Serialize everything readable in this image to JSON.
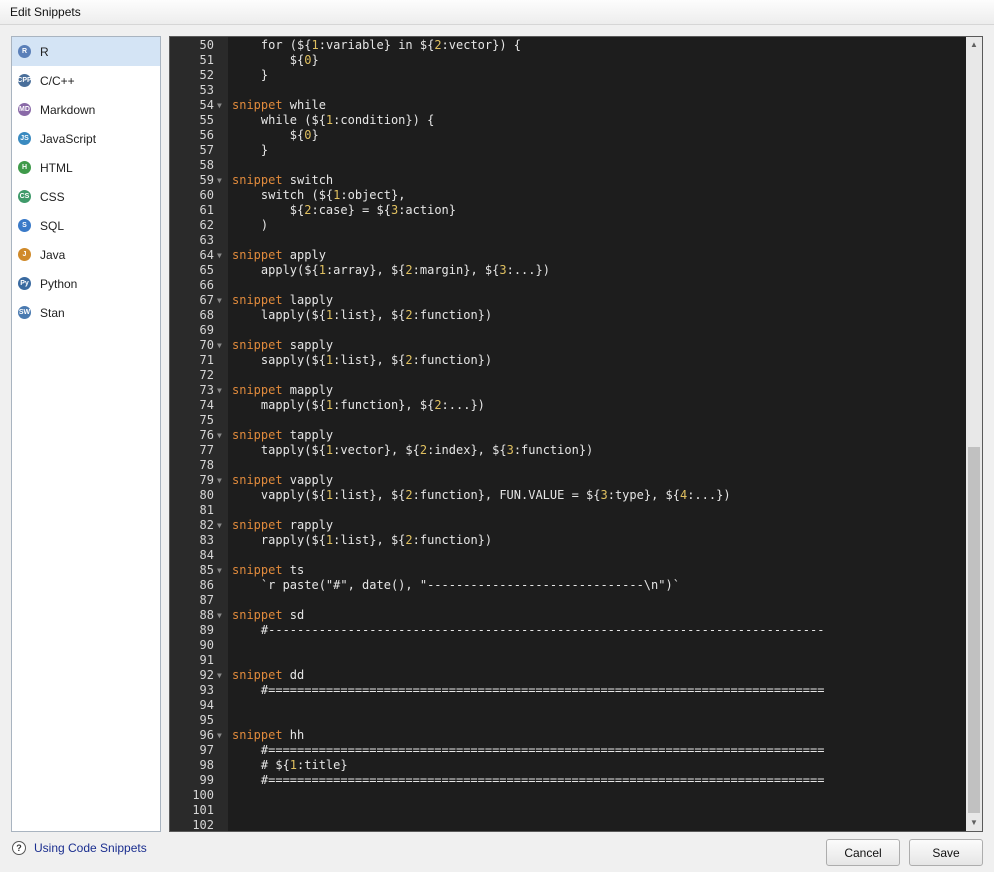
{
  "window": {
    "title": "Edit Snippets"
  },
  "languages": [
    {
      "label": "R",
      "icon": "r-icon",
      "color": "#5a7fb8",
      "glyph": "R",
      "selected": true
    },
    {
      "label": "C/C++",
      "icon": "cpp-icon",
      "color": "#4a6f9a",
      "glyph": "CPP",
      "selected": false
    },
    {
      "label": "Markdown",
      "icon": "markdown-icon",
      "color": "#8a6aa8",
      "glyph": "MD",
      "selected": false
    },
    {
      "label": "JavaScript",
      "icon": "javascript-icon",
      "color": "#3a8ac0",
      "glyph": "JS",
      "selected": false
    },
    {
      "label": "HTML",
      "icon": "html-icon",
      "color": "#3f9a4a",
      "glyph": "H",
      "selected": false
    },
    {
      "label": "CSS",
      "icon": "css-icon",
      "color": "#3f9a6a",
      "glyph": "CS",
      "selected": false
    },
    {
      "label": "SQL",
      "icon": "sql-icon",
      "color": "#3a7ac8",
      "glyph": "S",
      "selected": false
    },
    {
      "label": "Java",
      "icon": "java-icon",
      "color": "#d08a2a",
      "glyph": "J",
      "selected": false
    },
    {
      "label": "Python",
      "icon": "python-icon",
      "color": "#3a6aa0",
      "glyph": "Py",
      "selected": false
    },
    {
      "label": "Stan",
      "icon": "stan-icon",
      "color": "#4a7ab0",
      "glyph": "SW",
      "selected": false
    }
  ],
  "code_lines": [
    {
      "n": "50",
      "fold": false,
      "segs": [
        [
          "t",
          "    for ("
        ],
        [
          "t",
          "${"
        ],
        [
          "n",
          "1"
        ],
        [
          "t",
          ":variable} in ${"
        ],
        [
          "n",
          "2"
        ],
        [
          "t",
          ":vector}) {"
        ]
      ]
    },
    {
      "n": "51",
      "fold": false,
      "segs": [
        [
          "t",
          "        ${"
        ],
        [
          "n",
          "0"
        ],
        [
          "t",
          "}"
        ]
      ]
    },
    {
      "n": "52",
      "fold": false,
      "segs": [
        [
          "t",
          "    }"
        ]
      ]
    },
    {
      "n": "53",
      "fold": false,
      "segs": []
    },
    {
      "n": "54",
      "fold": true,
      "segs": [
        [
          "k",
          "snippet"
        ],
        [
          "t",
          " while"
        ]
      ]
    },
    {
      "n": "55",
      "fold": false,
      "segs": [
        [
          "t",
          "    while (${"
        ],
        [
          "n",
          "1"
        ],
        [
          "t",
          ":condition}) {"
        ]
      ]
    },
    {
      "n": "56",
      "fold": false,
      "segs": [
        [
          "t",
          "        ${"
        ],
        [
          "n",
          "0"
        ],
        [
          "t",
          "}"
        ]
      ]
    },
    {
      "n": "57",
      "fold": false,
      "segs": [
        [
          "t",
          "    }"
        ]
      ]
    },
    {
      "n": "58",
      "fold": false,
      "segs": []
    },
    {
      "n": "59",
      "fold": true,
      "segs": [
        [
          "k",
          "snippet"
        ],
        [
          "t",
          " switch"
        ]
      ]
    },
    {
      "n": "60",
      "fold": false,
      "segs": [
        [
          "t",
          "    switch (${"
        ],
        [
          "n",
          "1"
        ],
        [
          "t",
          ":object},"
        ]
      ]
    },
    {
      "n": "61",
      "fold": false,
      "segs": [
        [
          "t",
          "        ${"
        ],
        [
          "n",
          "2"
        ],
        [
          "t",
          ":case} = ${"
        ],
        [
          "n",
          "3"
        ],
        [
          "t",
          ":action}"
        ]
      ]
    },
    {
      "n": "62",
      "fold": false,
      "segs": [
        [
          "t",
          "    )"
        ]
      ]
    },
    {
      "n": "63",
      "fold": false,
      "segs": []
    },
    {
      "n": "64",
      "fold": true,
      "segs": [
        [
          "k",
          "snippet"
        ],
        [
          "t",
          " apply"
        ]
      ]
    },
    {
      "n": "65",
      "fold": false,
      "segs": [
        [
          "t",
          "    apply(${"
        ],
        [
          "n",
          "1"
        ],
        [
          "t",
          ":array}, ${"
        ],
        [
          "n",
          "2"
        ],
        [
          "t",
          ":margin}, ${"
        ],
        [
          "n",
          "3"
        ],
        [
          "t",
          ":...})"
        ]
      ]
    },
    {
      "n": "66",
      "fold": false,
      "segs": []
    },
    {
      "n": "67",
      "fold": true,
      "segs": [
        [
          "k",
          "snippet"
        ],
        [
          "t",
          " lapply"
        ]
      ]
    },
    {
      "n": "68",
      "fold": false,
      "segs": [
        [
          "t",
          "    lapply(${"
        ],
        [
          "n",
          "1"
        ],
        [
          "t",
          ":list}, ${"
        ],
        [
          "n",
          "2"
        ],
        [
          "t",
          ":function})"
        ]
      ]
    },
    {
      "n": "69",
      "fold": false,
      "segs": []
    },
    {
      "n": "70",
      "fold": true,
      "segs": [
        [
          "k",
          "snippet"
        ],
        [
          "t",
          " sapply"
        ]
      ]
    },
    {
      "n": "71",
      "fold": false,
      "segs": [
        [
          "t",
          "    sapply(${"
        ],
        [
          "n",
          "1"
        ],
        [
          "t",
          ":list}, ${"
        ],
        [
          "n",
          "2"
        ],
        [
          "t",
          ":function})"
        ]
      ]
    },
    {
      "n": "72",
      "fold": false,
      "segs": []
    },
    {
      "n": "73",
      "fold": true,
      "segs": [
        [
          "k",
          "snippet"
        ],
        [
          "t",
          " mapply"
        ]
      ]
    },
    {
      "n": "74",
      "fold": false,
      "segs": [
        [
          "t",
          "    mapply(${"
        ],
        [
          "n",
          "1"
        ],
        [
          "t",
          ":function}, ${"
        ],
        [
          "n",
          "2"
        ],
        [
          "t",
          ":...})"
        ]
      ]
    },
    {
      "n": "75",
      "fold": false,
      "segs": []
    },
    {
      "n": "76",
      "fold": true,
      "segs": [
        [
          "k",
          "snippet"
        ],
        [
          "t",
          " tapply"
        ]
      ]
    },
    {
      "n": "77",
      "fold": false,
      "segs": [
        [
          "t",
          "    tapply(${"
        ],
        [
          "n",
          "1"
        ],
        [
          "t",
          ":vector}, ${"
        ],
        [
          "n",
          "2"
        ],
        [
          "t",
          ":index}, ${"
        ],
        [
          "n",
          "3"
        ],
        [
          "t",
          ":function})"
        ]
      ]
    },
    {
      "n": "78",
      "fold": false,
      "segs": []
    },
    {
      "n": "79",
      "fold": true,
      "segs": [
        [
          "k",
          "snippet"
        ],
        [
          "t",
          " vapply"
        ]
      ]
    },
    {
      "n": "80",
      "fold": false,
      "segs": [
        [
          "t",
          "    vapply(${"
        ],
        [
          "n",
          "1"
        ],
        [
          "t",
          ":list}, ${"
        ],
        [
          "n",
          "2"
        ],
        [
          "t",
          ":function}, FUN.VALUE = ${"
        ],
        [
          "n",
          "3"
        ],
        [
          "t",
          ":type}, ${"
        ],
        [
          "n",
          "4"
        ],
        [
          "t",
          ":...})"
        ]
      ]
    },
    {
      "n": "81",
      "fold": false,
      "segs": []
    },
    {
      "n": "82",
      "fold": true,
      "segs": [
        [
          "k",
          "snippet"
        ],
        [
          "t",
          " rapply"
        ]
      ]
    },
    {
      "n": "83",
      "fold": false,
      "segs": [
        [
          "t",
          "    rapply(${"
        ],
        [
          "n",
          "1"
        ],
        [
          "t",
          ":list}, ${"
        ],
        [
          "n",
          "2"
        ],
        [
          "t",
          ":function})"
        ]
      ]
    },
    {
      "n": "84",
      "fold": false,
      "segs": []
    },
    {
      "n": "85",
      "fold": true,
      "segs": [
        [
          "k",
          "snippet"
        ],
        [
          "t",
          " ts"
        ]
      ]
    },
    {
      "n": "86",
      "fold": false,
      "segs": [
        [
          "t",
          "    `r paste(\"#\", date(), \"------------------------------\\n\")`"
        ]
      ]
    },
    {
      "n": "87",
      "fold": false,
      "segs": []
    },
    {
      "n": "88",
      "fold": true,
      "segs": [
        [
          "k",
          "snippet"
        ],
        [
          "t",
          " sd"
        ]
      ]
    },
    {
      "n": "89",
      "fold": false,
      "segs": [
        [
          "t",
          "    #-----------------------------------------------------------------------------"
        ]
      ]
    },
    {
      "n": "90",
      "fold": false,
      "segs": []
    },
    {
      "n": "91",
      "fold": false,
      "segs": []
    },
    {
      "n": "92",
      "fold": true,
      "segs": [
        [
          "k",
          "snippet"
        ],
        [
          "t",
          " dd"
        ]
      ]
    },
    {
      "n": "93",
      "fold": false,
      "segs": [
        [
          "t",
          "    #============================================================================="
        ]
      ]
    },
    {
      "n": "94",
      "fold": false,
      "segs": []
    },
    {
      "n": "95",
      "fold": false,
      "segs": []
    },
    {
      "n": "96",
      "fold": true,
      "segs": [
        [
          "k",
          "snippet"
        ],
        [
          "t",
          " hh"
        ]
      ]
    },
    {
      "n": "97",
      "fold": false,
      "segs": [
        [
          "t",
          "    #============================================================================="
        ]
      ]
    },
    {
      "n": "98",
      "fold": false,
      "segs": [
        [
          "t",
          "    # ${"
        ],
        [
          "n",
          "1"
        ],
        [
          "t",
          ":title}"
        ]
      ]
    },
    {
      "n": "99",
      "fold": false,
      "segs": [
        [
          "t",
          "    #============================================================================="
        ]
      ]
    },
    {
      "n": "100",
      "fold": false,
      "segs": []
    },
    {
      "n": "101",
      "fold": false,
      "segs": []
    },
    {
      "n": "102",
      "fold": false,
      "segs": []
    }
  ],
  "footer": {
    "help_label": "Using Code Snippets",
    "cancel_label": "Cancel",
    "save_label": "Save"
  },
  "colors": {
    "keyword": "#e08a3c",
    "number": "#e0c060",
    "text": "#e6e6e6"
  }
}
